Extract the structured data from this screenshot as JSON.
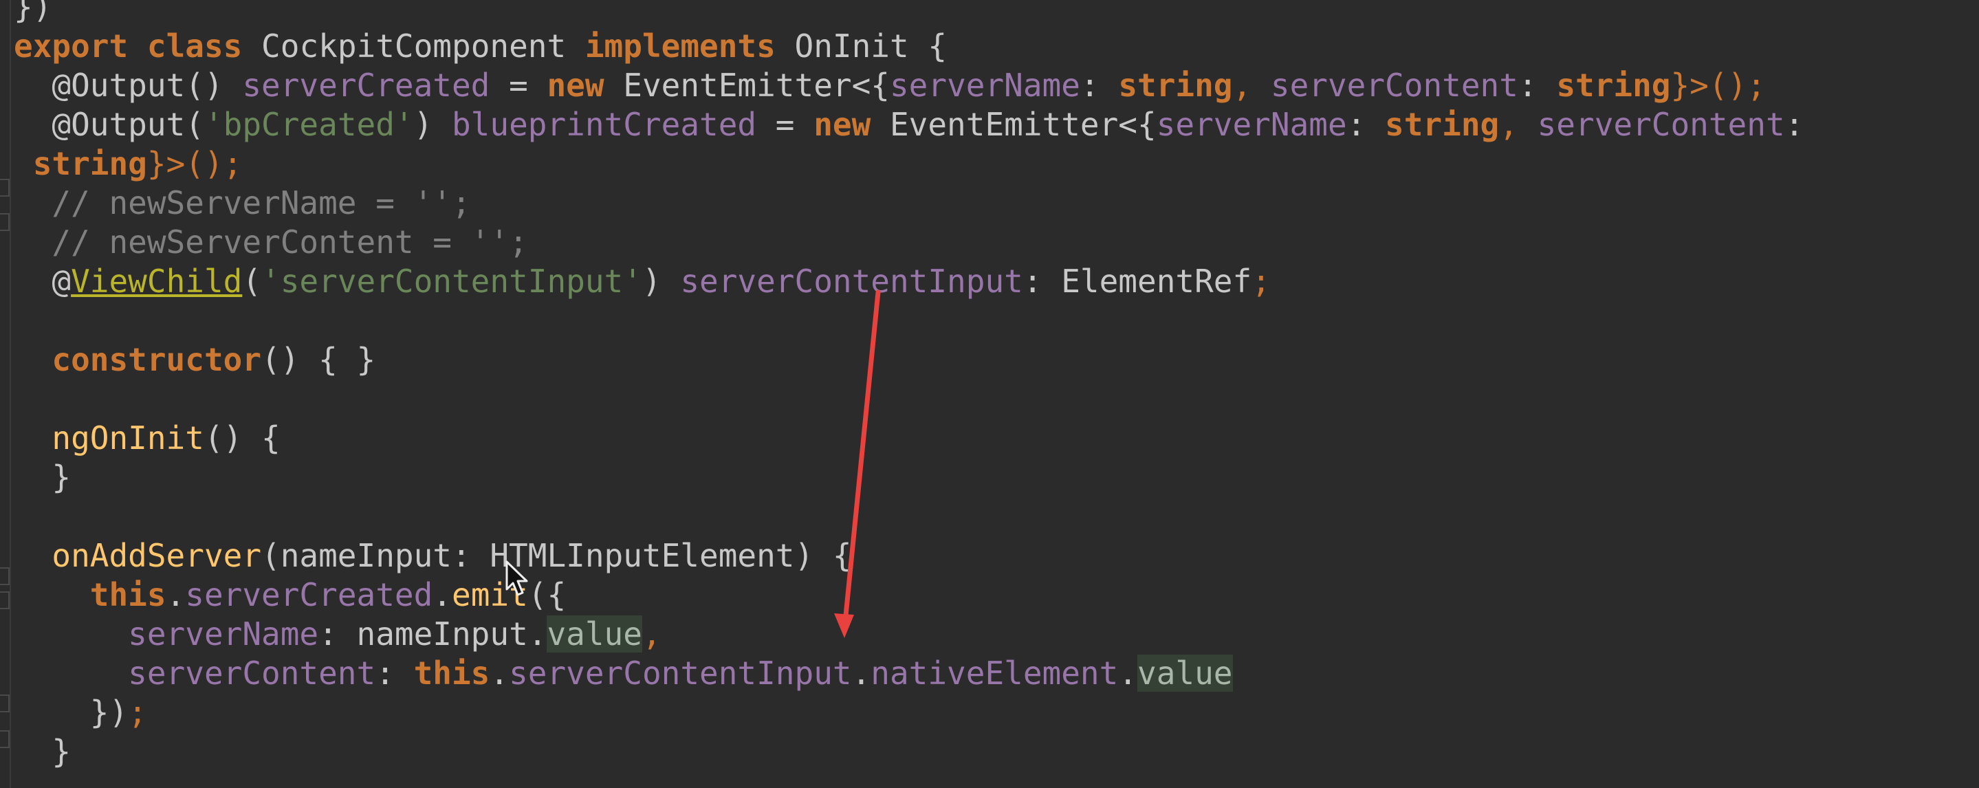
{
  "editor": {
    "lines": [
      {
        "tokens": [
          {
            "t": "})",
            "c": "plain"
          }
        ]
      },
      {
        "tokens": [
          {
            "t": "export",
            "c": "kw"
          },
          {
            "t": " ",
            "c": "plain"
          },
          {
            "t": "class",
            "c": "kw"
          },
          {
            "t": " CockpitComponent ",
            "c": "plain"
          },
          {
            "t": "implements",
            "c": "kw"
          },
          {
            "t": " OnInit {",
            "c": "plain"
          }
        ]
      },
      {
        "tokens": [
          {
            "t": "  @Output",
            "c": "plain"
          },
          {
            "t": "() ",
            "c": "plain"
          },
          {
            "t": "serverCreated",
            "c": "fld"
          },
          {
            "t": " = ",
            "c": "plain"
          },
          {
            "t": "new",
            "c": "kw"
          },
          {
            "t": " EventEmitter<{",
            "c": "plain"
          },
          {
            "t": "serverName",
            "c": "fld"
          },
          {
            "t": ": ",
            "c": "plain"
          },
          {
            "t": "string",
            "c": "kw"
          },
          {
            "t": ", ",
            "c": "semi"
          },
          {
            "t": "serverContent",
            "c": "fld"
          },
          {
            "t": ": ",
            "c": "plain"
          },
          {
            "t": "string",
            "c": "kw"
          },
          {
            "t": "}>();",
            "c": "semi"
          }
        ]
      },
      {
        "tokens": [
          {
            "t": "  @Output(",
            "c": "plain"
          },
          {
            "t": "'bpCreated'",
            "c": "str"
          },
          {
            "t": ") ",
            "c": "plain"
          },
          {
            "t": "blueprintCreated",
            "c": "fld"
          },
          {
            "t": " = ",
            "c": "plain"
          },
          {
            "t": "new",
            "c": "kw"
          },
          {
            "t": " EventEmitter<{",
            "c": "plain"
          },
          {
            "t": "serverName",
            "c": "fld"
          },
          {
            "t": ": ",
            "c": "plain"
          },
          {
            "t": "string",
            "c": "kw"
          },
          {
            "t": ", ",
            "c": "semi"
          },
          {
            "t": "serverContent",
            "c": "fld"
          },
          {
            "t": ":",
            "c": "plain"
          }
        ]
      },
      {
        "tokens": [
          {
            "t": " string",
            "c": "kw"
          },
          {
            "t": "}>();",
            "c": "semi"
          }
        ]
      },
      {
        "tokens": [
          {
            "t": "  // newServerName = '';",
            "c": "cmt"
          }
        ]
      },
      {
        "tokens": [
          {
            "t": "  // newServerContent = '';",
            "c": "cmt"
          }
        ]
      },
      {
        "tokens": [
          {
            "t": "  @",
            "c": "plain"
          },
          {
            "t": "ViewChild",
            "c": "annu"
          },
          {
            "t": "(",
            "c": "plain"
          },
          {
            "t": "'serverContentInput'",
            "c": "str"
          },
          {
            "t": ") ",
            "c": "plain"
          },
          {
            "t": "serverContentInput",
            "c": "fld"
          },
          {
            "t": ": ElementRef",
            "c": "plain"
          },
          {
            "t": ";",
            "c": "semi"
          }
        ]
      },
      {
        "tokens": [
          {
            "t": "",
            "c": "plain"
          }
        ]
      },
      {
        "tokens": [
          {
            "t": "  ",
            "c": "plain"
          },
          {
            "t": "constructor",
            "c": "kw"
          },
          {
            "t": "() { }",
            "c": "plain"
          }
        ]
      },
      {
        "tokens": [
          {
            "t": "",
            "c": "plain"
          }
        ]
      },
      {
        "tokens": [
          {
            "t": "  ",
            "c": "plain"
          },
          {
            "t": "ngOnInit",
            "c": "fn"
          },
          {
            "t": "() {",
            "c": "plain"
          }
        ]
      },
      {
        "tokens": [
          {
            "t": "  }",
            "c": "plain"
          }
        ]
      },
      {
        "tokens": [
          {
            "t": "",
            "c": "plain"
          }
        ]
      },
      {
        "tokens": [
          {
            "t": "  ",
            "c": "plain"
          },
          {
            "t": "onAddServer",
            "c": "fn"
          },
          {
            "t": "(nameInput: HTMLInputElement) {",
            "c": "plain"
          }
        ]
      },
      {
        "tokens": [
          {
            "t": "    ",
            "c": "plain"
          },
          {
            "t": "this",
            "c": "kw"
          },
          {
            "t": ".",
            "c": "plain"
          },
          {
            "t": "serverCreated",
            "c": "fld"
          },
          {
            "t": ".",
            "c": "plain"
          },
          {
            "t": "emit",
            "c": "fn"
          },
          {
            "t": "({",
            "c": "plain"
          }
        ]
      },
      {
        "tokens": [
          {
            "t": "      ",
            "c": "plain"
          },
          {
            "t": "serverName",
            "c": "fld"
          },
          {
            "t": ": nameInput.",
            "c": "plain"
          },
          {
            "t": "value",
            "c": "hl"
          },
          {
            "t": ",",
            "c": "semi"
          }
        ]
      },
      {
        "tokens": [
          {
            "t": "      ",
            "c": "plain"
          },
          {
            "t": "serverContent",
            "c": "fld"
          },
          {
            "t": ": ",
            "c": "plain"
          },
          {
            "t": "this",
            "c": "kw"
          },
          {
            "t": ".",
            "c": "plain"
          },
          {
            "t": "serverContentInput",
            "c": "fld"
          },
          {
            "t": ".",
            "c": "plain"
          },
          {
            "t": "nativeElement",
            "c": "fld"
          },
          {
            "t": ".",
            "c": "plain"
          },
          {
            "t": "value",
            "c": "hl"
          }
        ]
      },
      {
        "tokens": [
          {
            "t": "    })",
            "c": "plain"
          },
          {
            "t": ";",
            "c": "semi"
          }
        ]
      },
      {
        "tokens": [
          {
            "t": "  }",
            "c": "plain"
          }
        ]
      }
    ],
    "annotation": {
      "color": "#e8413e"
    }
  }
}
